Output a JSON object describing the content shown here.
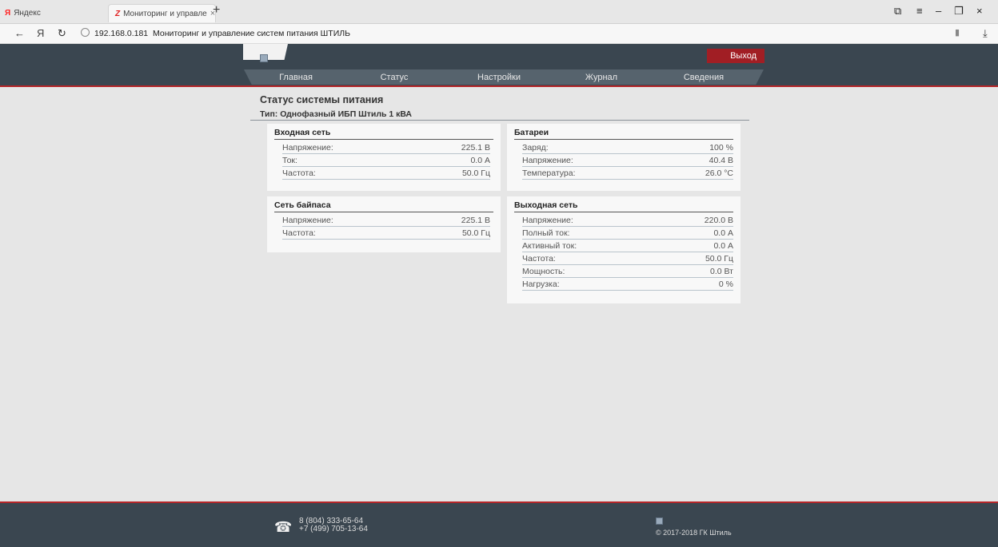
{
  "browser": {
    "tab_inactive": "Яндекс",
    "tab_active": "Мониторинг и управле",
    "tab_close": "×",
    "new_tab": "+",
    "url_host": "192.168.0.181",
    "url_title": "Мониторинг и управление систем питания ШТИЛЬ"
  },
  "header": {
    "exit_label": "Выход",
    "menu": [
      "Главная",
      "Статус",
      "Настройки",
      "Журнал",
      "Сведения"
    ]
  },
  "page": {
    "title": "Статус системы питания",
    "subtitle": "Тип: Однофазный ИБП Штиль 1 кВА"
  },
  "panels": {
    "input": {
      "title": "Входная сеть",
      "rows": [
        {
          "label": "Напряжение:",
          "value": "225.1 В"
        },
        {
          "label": "Ток:",
          "value": "0.0 А"
        },
        {
          "label": "Частота:",
          "value": "50.0 Гц"
        }
      ]
    },
    "battery": {
      "title": "Батареи",
      "rows": [
        {
          "label": "Заряд:",
          "value": "100 %"
        },
        {
          "label": "Напряжение:",
          "value": "40.4 В"
        },
        {
          "label": "Температура:",
          "value": "26.0 °C"
        }
      ]
    },
    "bypass": {
      "title": "Сеть байпаса",
      "rows": [
        {
          "label": "Напряжение:",
          "value": "225.1 В"
        },
        {
          "label": "Частота:",
          "value": "50.0 Гц"
        }
      ]
    },
    "output": {
      "title": "Выходная сеть",
      "rows": [
        {
          "label": "Напряжение:",
          "value": "220.0 В"
        },
        {
          "label": "Полный ток:",
          "value": "0.0 А"
        },
        {
          "label": "Активный ток:",
          "value": "0.0 А"
        },
        {
          "label": "Частота:",
          "value": "50.0 Гц"
        },
        {
          "label": "Мощность:",
          "value": "0.0 Вт"
        },
        {
          "label": "Нагрузка:",
          "value": "0 %"
        }
      ]
    }
  },
  "footer": {
    "phone1": "8 (804) 333-65-64",
    "phone2": "+7 (499) 705-13-64",
    "copyright": "© 2017-2018 ГК Штиль"
  },
  "colors": {
    "header_bg": "#3a4650",
    "accent_red": "#b52528",
    "exit_bg": "#a11e24",
    "page_bg": "#e6e6e6"
  }
}
